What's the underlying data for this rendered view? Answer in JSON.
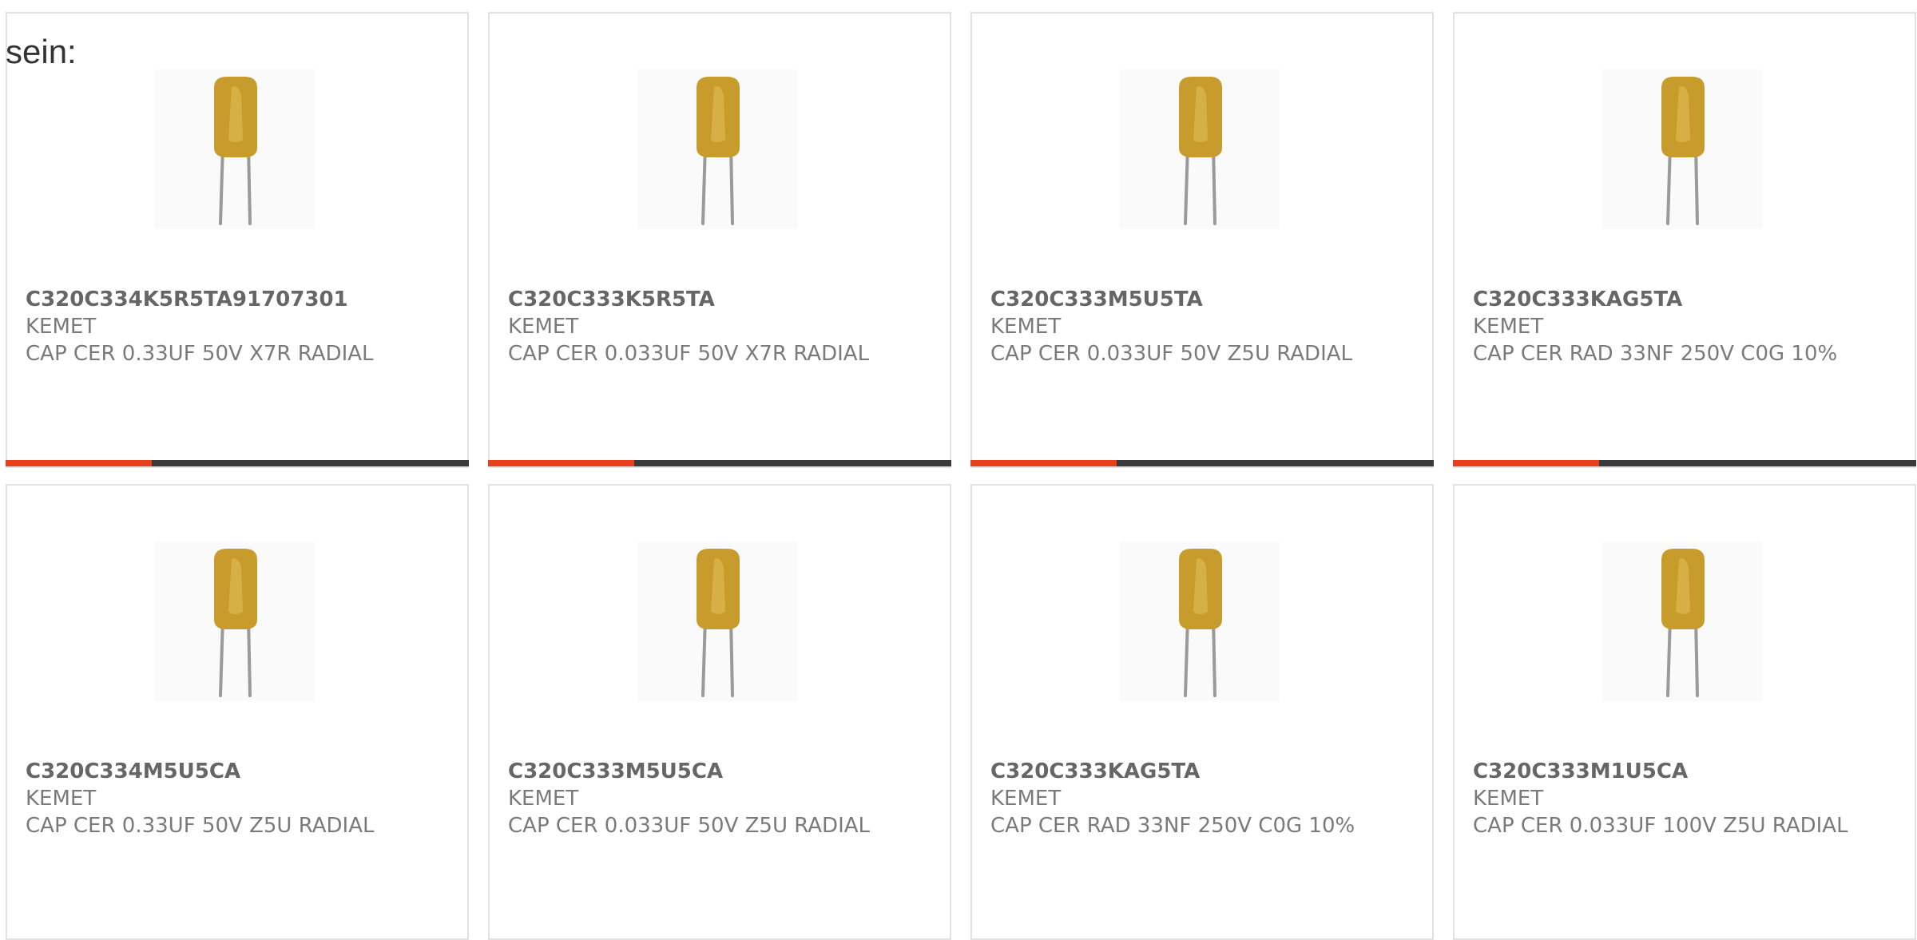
{
  "intro_text": "sein:",
  "accent_color": "#e8401c",
  "products": [
    {
      "part_number": "C320C334K5R5TA91707301",
      "manufacturer": "KEMET",
      "description": "CAP CER 0.33UF 50V X7R RADIAL",
      "image": "capacitor-image",
      "progress": 0.315
    },
    {
      "part_number": "C320C333K5R5TA",
      "manufacturer": "KEMET",
      "description": "CAP CER 0.033UF 50V X7R RADIAL",
      "image": "capacitor-image",
      "progress": 0.315
    },
    {
      "part_number": "C320C333M5U5TA",
      "manufacturer": "KEMET",
      "description": "CAP CER 0.033UF 50V Z5U RADIAL",
      "image": "capacitor-image",
      "progress": 0.315
    },
    {
      "part_number": "C320C333KAG5TA",
      "manufacturer": "KEMET",
      "description": "CAP CER RAD 33NF 250V C0G 10%",
      "image": "capacitor-image",
      "progress": 0.315
    },
    {
      "part_number": "C320C334M5U5CA",
      "manufacturer": "KEMET",
      "description": "CAP CER 0.33UF 50V Z5U RADIAL",
      "image": "capacitor-image"
    },
    {
      "part_number": "C320C333M5U5CA",
      "manufacturer": "KEMET",
      "description": "CAP CER 0.033UF 50V Z5U RADIAL",
      "image": "capacitor-image"
    },
    {
      "part_number": "C320C333KAG5TA",
      "manufacturer": "KEMET",
      "description": "CAP CER RAD 33NF 250V C0G 10%",
      "image": "capacitor-image"
    },
    {
      "part_number": "C320C333M1U5CA",
      "manufacturer": "KEMET",
      "description": "CAP CER 0.033UF 100V Z5U RADIAL",
      "image": "capacitor-image"
    }
  ]
}
